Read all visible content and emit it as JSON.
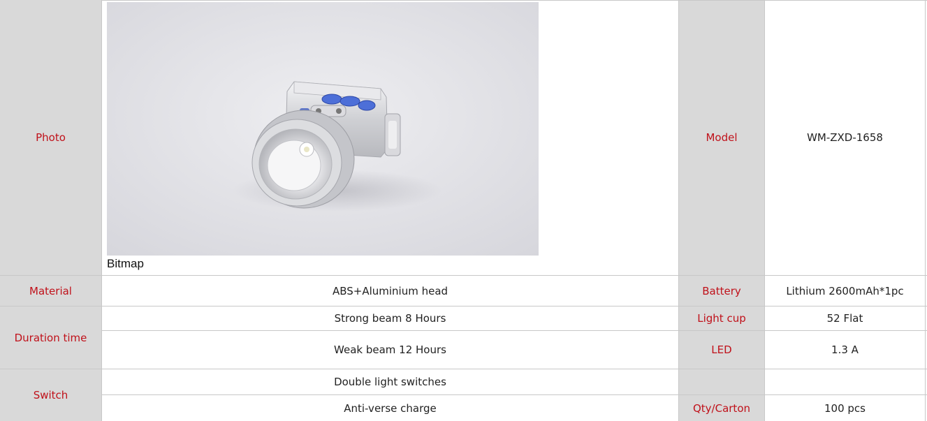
{
  "rows": {
    "photo_label": "Photo",
    "image_caption": "Bitmap",
    "model_label": "Model",
    "model_value": "WM-ZXD-1658",
    "material_label": "Material",
    "material_value": "ABS+Aluminium head",
    "battery_label": "Battery",
    "battery_value": "Lithium 2600mAh*1pc",
    "duration_label": "Duration time",
    "strong_beam": "Strong beam 8 Hours",
    "weak_beam": "Weak beam 12 Hours",
    "lightcup_label": "Light cup",
    "lightcup_value": "52 Flat",
    "led_label": "LED",
    "led_value": "1.3 A",
    "switch_label": "Switch",
    "switch_value1": "Double light switches",
    "switch_value2": "Anti-verse charge",
    "qty_label": "Qty/Carton",
    "qty_value": "100 pcs"
  },
  "colors": {
    "label_bg": "#d9d9d9",
    "label_text": "#c0111a",
    "border": "#c8c8c8"
  },
  "icons": [
    "headlamp-product-photo"
  ]
}
